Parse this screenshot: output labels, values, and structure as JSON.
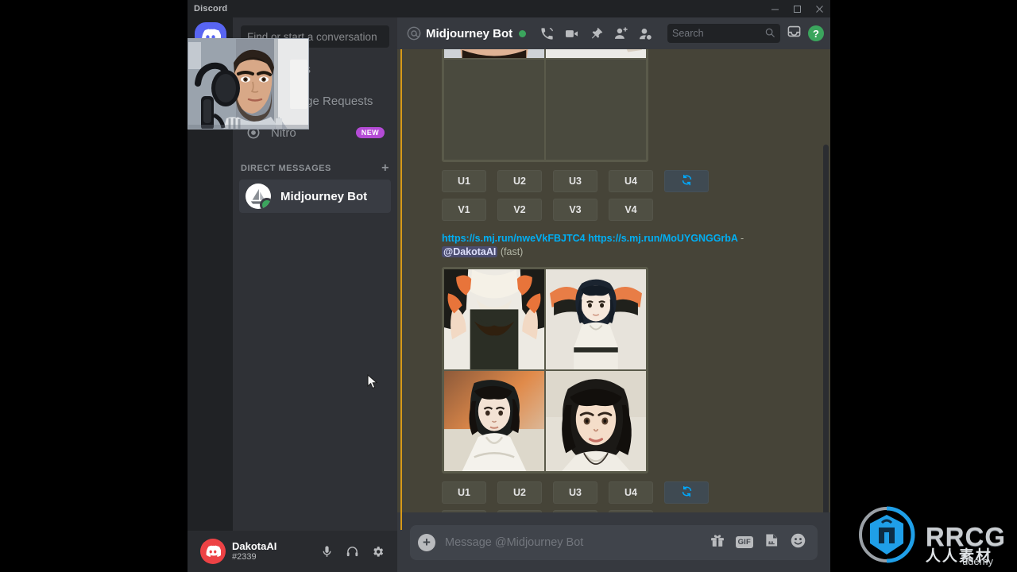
{
  "window": {
    "title": "Discord",
    "controls": {
      "minimize": "minimize-icon",
      "maximize": "maximize-icon",
      "close": "close-icon"
    }
  },
  "rail": {
    "items": [
      {
        "name": "home-discord-button",
        "icon": "discord-logo-icon",
        "label": ""
      },
      {
        "name": "explore-servers-button",
        "icon": "compass-icon",
        "label": ""
      }
    ]
  },
  "sidebar": {
    "search_placeholder": "Find or start a conversation",
    "nav": [
      {
        "label": "Friends",
        "icon": "friends-icon"
      },
      {
        "label": "Message Requests",
        "icon": "inbox-icon"
      },
      {
        "label": "Nitro",
        "icon": "nitro-icon",
        "badge": "NEW"
      }
    ],
    "dm_header": "DIRECT MESSAGES",
    "dm_add": "+",
    "dms": [
      {
        "name": "Midjourney Bot",
        "status": "online"
      }
    ]
  },
  "user_panel": {
    "username": "DakotaAI",
    "discriminator": "#2339",
    "icons": [
      "mic-icon",
      "headphones-icon",
      "gear-icon"
    ]
  },
  "channel_header": {
    "at": "@",
    "name": "Midjourney Bot",
    "status": "online",
    "icons": [
      "call-icon",
      "video-icon",
      "pin-icon",
      "add-friend-icon",
      "user-profile-icon"
    ],
    "search_placeholder": "Search",
    "right_icons": [
      "inbox-icon",
      "help-icon"
    ],
    "help_label": "?"
  },
  "messages": {
    "top_image_alt": "upscaled midjourney result",
    "blocks": [
      {
        "id": "block-1",
        "upscale_buttons": [
          "U1",
          "U2",
          "U3",
          "U4"
        ],
        "reroll_label": "reroll-icon",
        "variation_buttons": [
          "V1",
          "V2",
          "V3",
          "V4"
        ]
      },
      {
        "id": "block-2",
        "link_1": "https://s.mj.run/nweVkFBJTC4",
        "link_2": "https://s.mj.run/MoUYGNGGrbA",
        "separator": "-",
        "mention": "@DakotaAI",
        "speed": "(fast)",
        "upscale_buttons": [
          "U1",
          "U2",
          "U3",
          "U4"
        ],
        "reroll_label": "reroll-icon",
        "variation_buttons": [
          "V1",
          "V2",
          "V3",
          "V4"
        ]
      }
    ]
  },
  "composer": {
    "placeholder": "Message @Midjourney Bot",
    "add_label": "+",
    "gif_label": "GIF",
    "icons": [
      "gift-icon",
      "gif-icon",
      "sticker-icon",
      "emoji-icon"
    ]
  },
  "overlay": {
    "webcam_label": "webcam-video-feed"
  },
  "watermark": {
    "brand": "RRCG",
    "brand_cn": "人人素材",
    "source": "ûdemy"
  },
  "colors": {
    "accent_line": "#d89a18",
    "brand_blurple": "#5865f2",
    "online_green": "#3ba55d",
    "link_blue": "#00aff4",
    "chat_bg": "#464438",
    "sidebar_bg": "#2f3136",
    "rail_bg": "#202225"
  }
}
